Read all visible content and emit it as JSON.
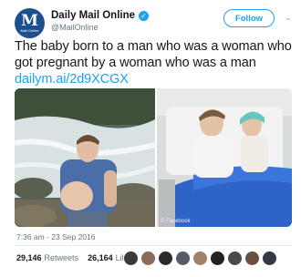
{
  "author": {
    "avatar_text": "M",
    "avatar_subtext": "Mail Online",
    "display_name": "Daily Mail Online",
    "handle": "@MailOnline",
    "verified_icon": "verified-badge-icon"
  },
  "actions": {
    "follow_label": "Follow",
    "menu_icon": "chevron-down-icon"
  },
  "tweet": {
    "text": "The baby born to a man who was a woman who got pregnant by a woman who was a man ",
    "link": "dailym.ai/2d9XCGX",
    "photo_credit": "© Facebook"
  },
  "timestamp": "7:36 am - 23 Sep 2016",
  "stats": {
    "retweets_count": "29,146",
    "retweets_label": "Retweets",
    "likes_count": "26,164",
    "likes_label": "Likes"
  },
  "colors": {
    "accent": "#1da1f2",
    "avatar": "#1b4f8f"
  }
}
